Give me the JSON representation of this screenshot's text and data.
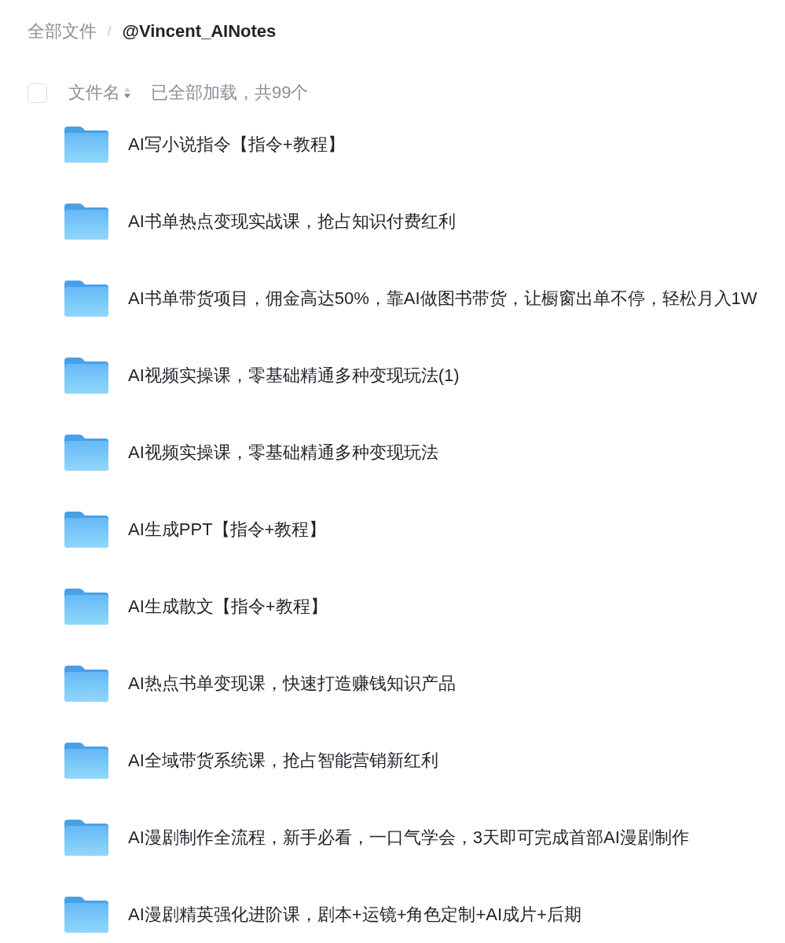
{
  "breadcrumb": {
    "items": [
      {
        "label": "全部文件",
        "current": false
      },
      {
        "label": "@Vincent_AINotes",
        "current": true
      }
    ],
    "separator": "/"
  },
  "header": {
    "select_all": {
      "checked": false
    },
    "column": {
      "label": "文件名",
      "sort_descending": true
    },
    "status": "已全部加载，共99个"
  },
  "files": [
    {
      "name": "AI写小说指令【指令+教程】"
    },
    {
      "name": "AI书单热点变现实战课，抢占知识付费红利"
    },
    {
      "name": "AI书单带货项目，佣金高达50%，靠AI做图书带货，让橱窗出单不停，轻松月入1W"
    },
    {
      "name": "AI视频实操课，零基础精通多种变现玩法(1)"
    },
    {
      "name": "AI视频实操课，零基础精通多种变现玩法"
    },
    {
      "name": "AI生成PPT【指令+教程】"
    },
    {
      "name": "AI生成散文【指令+教程】"
    },
    {
      "name": "AI热点书单变现课，快速打造赚钱知识产品"
    },
    {
      "name": "AI全域带货系统课，抢占智能营销新红利"
    },
    {
      "name": "AI漫剧制作全流程，新手必看，一口气学会，3天即可完成首部AI漫剧制作"
    },
    {
      "name": "AI漫剧精英强化进阶课，剧本+运镜+角色定制+AI成片+后期"
    }
  ]
}
